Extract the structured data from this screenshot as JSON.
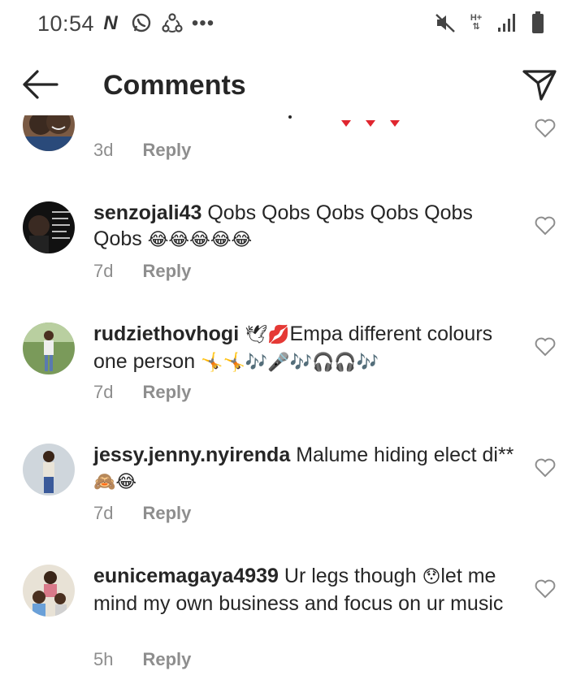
{
  "status_bar": {
    "time": "10:54",
    "left_icons": [
      "n-icon",
      "whatsapp-icon",
      "sync-icon",
      "more-dots-icon"
    ],
    "right_icons": [
      "mute-icon",
      "network-icon",
      "signal-icon",
      "battery-icon"
    ],
    "network_label": "H+"
  },
  "header": {
    "title": "Comments",
    "back_icon": "arrow-left-icon",
    "send_icon": "paper-plane-icon"
  },
  "comments": [
    {
      "username": "",
      "text": "",
      "age": "3d",
      "reply": "Reply",
      "partial": true
    },
    {
      "username": "senzojali43",
      "text": " Qobs Qobs Qobs Qobs Qobs Qobs ",
      "emojis": "😂😂😂😂😂",
      "age": "7d",
      "reply": "Reply"
    },
    {
      "username": "rudziethovhogi",
      "text_before": " 🕊💋",
      "text": "Empa different colours one person ",
      "emojis": "🤸🤸🎶🎤🎶🎧🎧🎶",
      "age": "7d",
      "reply": "Reply"
    },
    {
      "username": "jessy.jenny.nyirenda",
      "text": " Malume hiding elect di** ",
      "emojis": "🙈😂",
      "age": "7d",
      "reply": "Reply"
    },
    {
      "username": "eunicemagaya4939",
      "text": " Ur legs though ",
      "emojis": "😯",
      "text_after": "let me mind my own business and focus on ur music",
      "age": "5h",
      "reply": "Reply"
    }
  ],
  "colors": {
    "primary_text": "#262626",
    "secondary_text": "#8e8e8e",
    "background": "#ffffff",
    "accent_red": "#e0262f"
  }
}
